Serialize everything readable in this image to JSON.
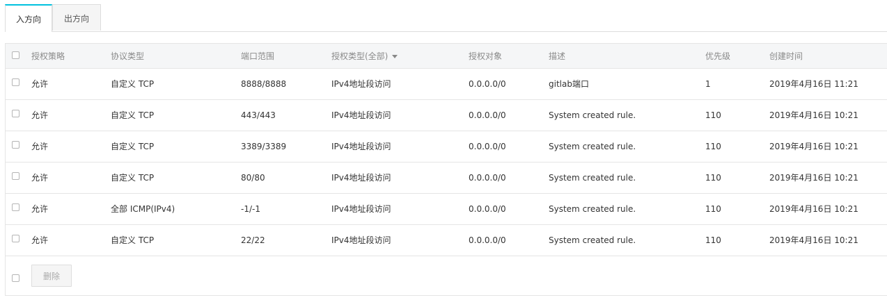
{
  "tabs": [
    {
      "label": "入方向",
      "active": true
    },
    {
      "label": "出方向",
      "active": false
    }
  ],
  "table": {
    "columns": [
      "授权策略",
      "协议类型",
      "端口范围",
      "授权类型(全部)",
      "授权对象",
      "描述",
      "优先级",
      "创建时间"
    ],
    "rows": [
      {
        "policy": "允许",
        "protocol": "自定义 TCP",
        "port": "8888/8888",
        "auth_type": "IPv4地址段访问",
        "target": "0.0.0.0/0",
        "desc": "gitlab端口",
        "priority": "1",
        "created": "2019年4月16日 11:21"
      },
      {
        "policy": "允许",
        "protocol": "自定义 TCP",
        "port": "443/443",
        "auth_type": "IPv4地址段访问",
        "target": "0.0.0.0/0",
        "desc": "System created rule.",
        "priority": "110",
        "created": "2019年4月16日 10:21"
      },
      {
        "policy": "允许",
        "protocol": "自定义 TCP",
        "port": "3389/3389",
        "auth_type": "IPv4地址段访问",
        "target": "0.0.0.0/0",
        "desc": "System created rule.",
        "priority": "110",
        "created": "2019年4月16日 10:21"
      },
      {
        "policy": "允许",
        "protocol": "自定义 TCP",
        "port": "80/80",
        "auth_type": "IPv4地址段访问",
        "target": "0.0.0.0/0",
        "desc": "System created rule.",
        "priority": "110",
        "created": "2019年4月16日 10:21"
      },
      {
        "policy": "允许",
        "protocol": "全部 ICMP(IPv4)",
        "port": "-1/-1",
        "auth_type": "IPv4地址段访问",
        "target": "0.0.0.0/0",
        "desc": "System created rule.",
        "priority": "110",
        "created": "2019年4月16日 10:21"
      },
      {
        "policy": "允许",
        "protocol": "自定义 TCP",
        "port": "22/22",
        "auth_type": "IPv4地址段访问",
        "target": "0.0.0.0/0",
        "desc": "System created rule.",
        "priority": "110",
        "created": "2019年4月16日 10:21"
      }
    ]
  },
  "footer": {
    "delete_label": "删除"
  },
  "colors": {
    "accent": "#00c1de",
    "header_bg": "#f5f6f7",
    "border": "#e5e5e5"
  }
}
